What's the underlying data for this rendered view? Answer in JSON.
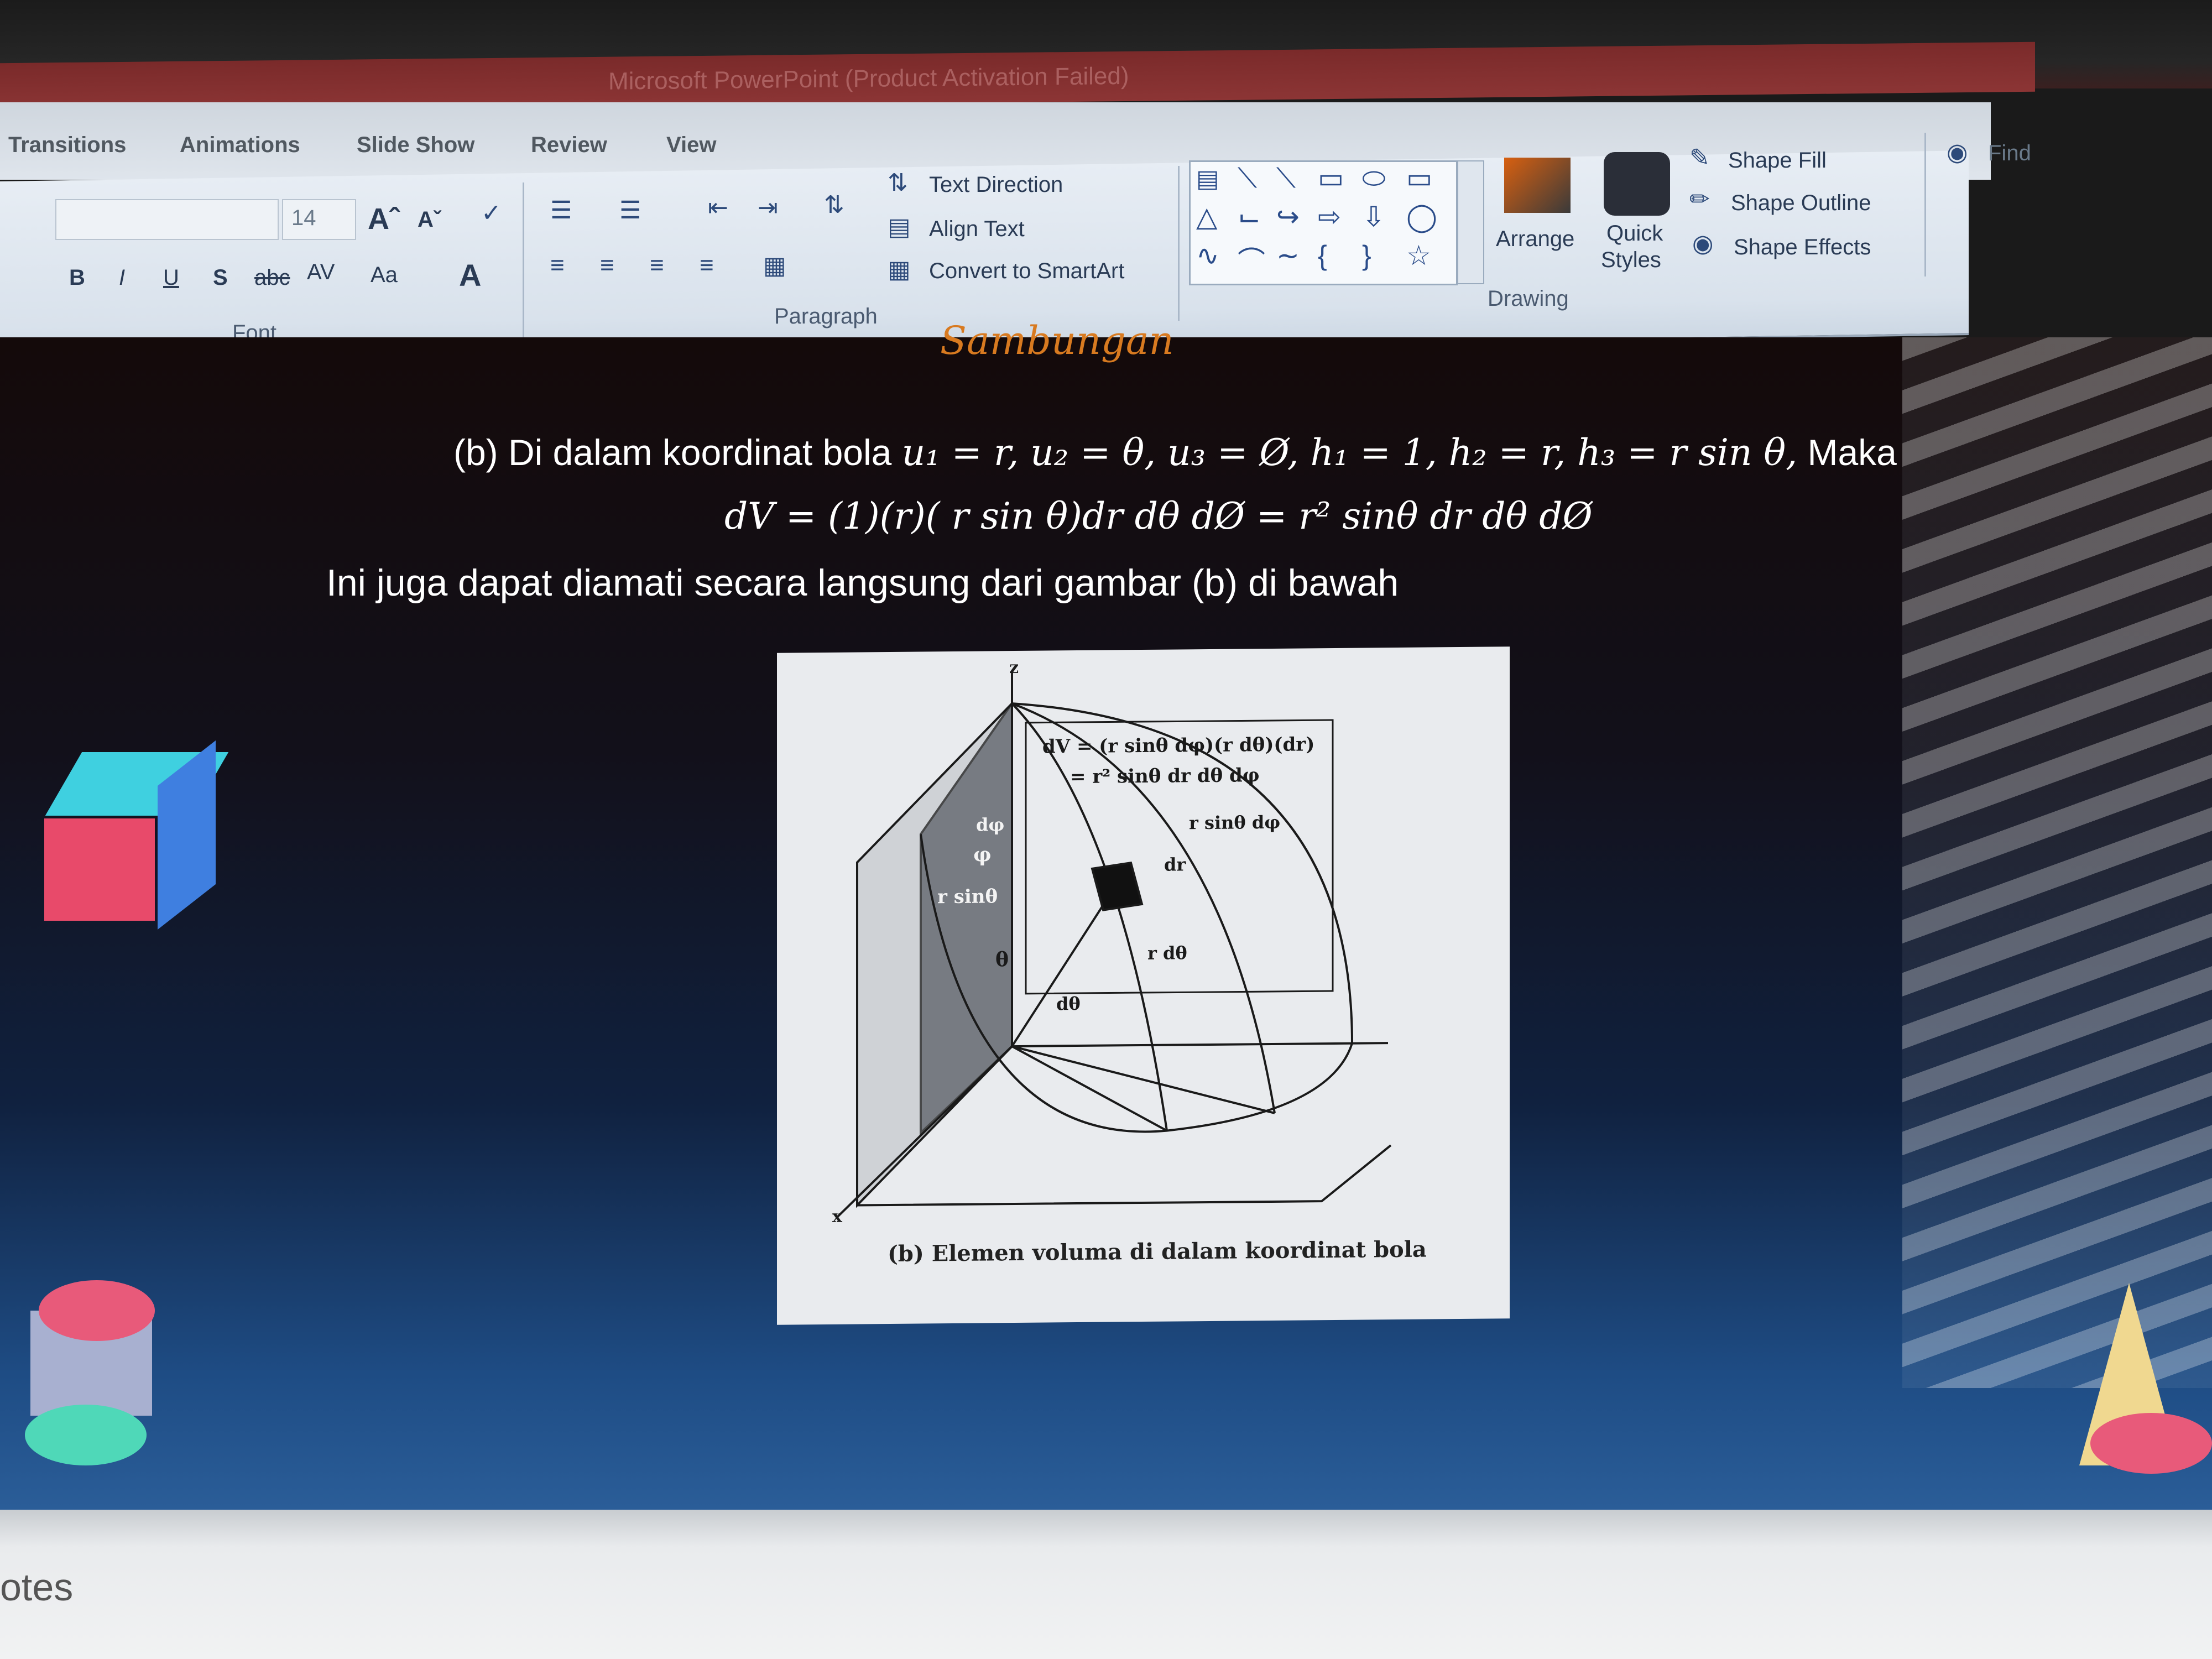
{
  "window": {
    "title": "Microsoft PowerPoint (Product Activation Failed)"
  },
  "tabs": [
    "Transitions",
    "Animations",
    "Slide Show",
    "Review",
    "View"
  ],
  "ribbon": {
    "font_group": {
      "label": "Font",
      "size": "14",
      "grow": "Aˆ",
      "shrink": "Aˇ",
      "strike": "abc",
      "spacing": "AV",
      "case": "Aa"
    },
    "paragraph_group": {
      "label": "Paragraph",
      "text_direction": "Text Direction",
      "align_text": "Align Text",
      "convert_smartart": "Convert to SmartArt"
    },
    "drawing_group": {
      "label": "Drawing",
      "arrange": "Arrange",
      "quick_styles_1": "Quick",
      "quick_styles_2": "Styles",
      "shape_fill": "Shape Fill",
      "shape_outline": "Shape Outline",
      "shape_effects": "Shape Effects"
    },
    "editing_group": {
      "find": "Find"
    }
  },
  "slide": {
    "subtitle": "Sambungan",
    "line1_prefix": "(b) Di dalam koordinat bola ",
    "line1_math": "u₁ = r, u₂ = θ, u₃ = Ø, h₁ = 1, h₂ = r, h₃ = r sin θ,",
    "line1_suffix": " Maka",
    "line2": "dV = (1)(r)( r sin θ)dr dθ dØ = r² sinθ dr dθ dØ",
    "line3": "Ini juga dapat diamati secara langsung dari gambar (b) di bawah",
    "figure": {
      "label_dv1": "dV = (r sinθ dφ)(r dθ)(dr)",
      "label_dv2": "= r² sinθ dr dθ dφ",
      "label_rsin_dphi": "r sinθ dφ",
      "label_rsin": "r sinθ",
      "label_dr": "dr",
      "label_rdtheta": "r dθ",
      "label_dtheta": "dθ",
      "label_theta": "θ",
      "label_dphi": "dφ",
      "label_phi": "φ",
      "axis_z": "z",
      "axis_x": "x",
      "caption": "(b)  Elemen voluma di dalam koordinat bola"
    }
  },
  "notes": {
    "label": "otes"
  }
}
